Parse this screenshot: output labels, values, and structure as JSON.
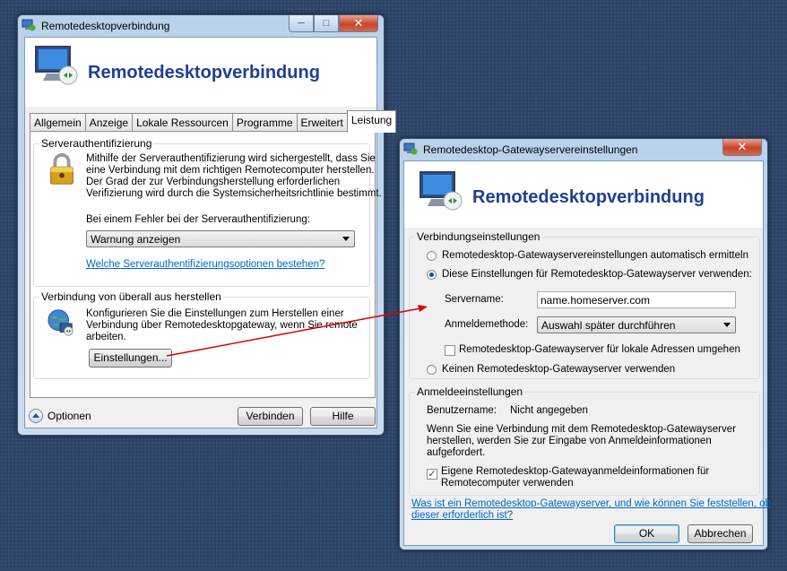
{
  "main_window": {
    "title": "Remotedesktopverbindung",
    "header_title": "Remotedesktopverbindung",
    "tabs": [
      "Allgemein",
      "Anzeige",
      "Lokale Ressourcen",
      "Programme",
      "Erweitert",
      "Leistung"
    ],
    "server_auth": {
      "group_title": "Serverauthentifizierung",
      "description_lines": [
        "Mithilfe der Serverauthentifizierung wird sichergestellt, dass Sie",
        "eine Verbindung mit dem richtigen Remotecomputer herstellen.",
        "Der Grad der zur Verbindungsherstellung erforderlichen",
        "Verifizierung wird durch die Systemsicherheitsrichtlinie bestimmt."
      ],
      "error_label": "Bei einem Fehler bei der Serverauthentifizierung:",
      "error_select_value": "Warnung anzeigen",
      "options_link": "Welche Serverauthentifizierungsoptionen bestehen?"
    },
    "connect_anywhere": {
      "group_title": "Verbindung von überall aus herstellen",
      "description_lines": [
        "Konfigurieren Sie die Einstellungen zum Herstellen einer",
        "Verbindung über Remotedesktopgateway, wenn Sie remote",
        "arbeiten."
      ],
      "settings_button": "Einstellungen..."
    },
    "options_label": "Optionen",
    "connect_button": "Verbinden",
    "help_button": "Hilfe"
  },
  "gateway_dialog": {
    "title": "Remotedesktop-Gatewayservereinstellungen",
    "header_title": "Remotedesktopverbindung",
    "connection_settings": {
      "group_title": "Verbindungseinstellungen",
      "radio_auto": "Remotedesktop-Gatewayservereinstellungen automatisch ermitteln",
      "radio_use": "Diese Einstellungen für Remotedesktop-Gatewayserver verwenden:",
      "server_name_label": "Servername:",
      "server_name_value": "name.homeserver.com",
      "logon_method_label": "Anmeldemethode:",
      "logon_method_value": "Auswahl später durchführen",
      "bypass_local_label": "Remotedesktop-Gatewayserver für lokale Adressen umgehen",
      "radio_none": "Keinen Remotedesktop-Gatewayserver verwenden"
    },
    "logon_settings": {
      "group_title": "Anmeldeeinstellungen",
      "username_label": "Benutzername:",
      "username_value": "Nicht angegeben",
      "info_lines": [
        "Wenn Sie eine Verbindung mit dem Remotedesktop-Gatewayserver",
        "herstellen, werden Sie zur Eingabe von Anmeldeinformationen",
        "aufgefordert."
      ],
      "use_credentials_lines": [
        "Eigene Remotedesktop-Gatewayanmeldeinformationen für",
        "Remotecomputer verwenden"
      ]
    },
    "help_link_lines": [
      "Was ist ein Remotedesktop-Gatewayserver, und wie können Sie feststellen, ob",
      "dieser erforderlich ist?"
    ],
    "ok_button": "OK",
    "cancel_button": "Abbrechen"
  },
  "colors": {
    "desktop": "#2e4466",
    "header_title": "#1f3f95",
    "link": "#0066cc",
    "annotation_arrow": "#e00000"
  },
  "radio_state": {
    "auto": false,
    "use_settings": true,
    "none": false
  },
  "checkbox_state": {
    "bypass_local": false,
    "use_credentials": true
  }
}
